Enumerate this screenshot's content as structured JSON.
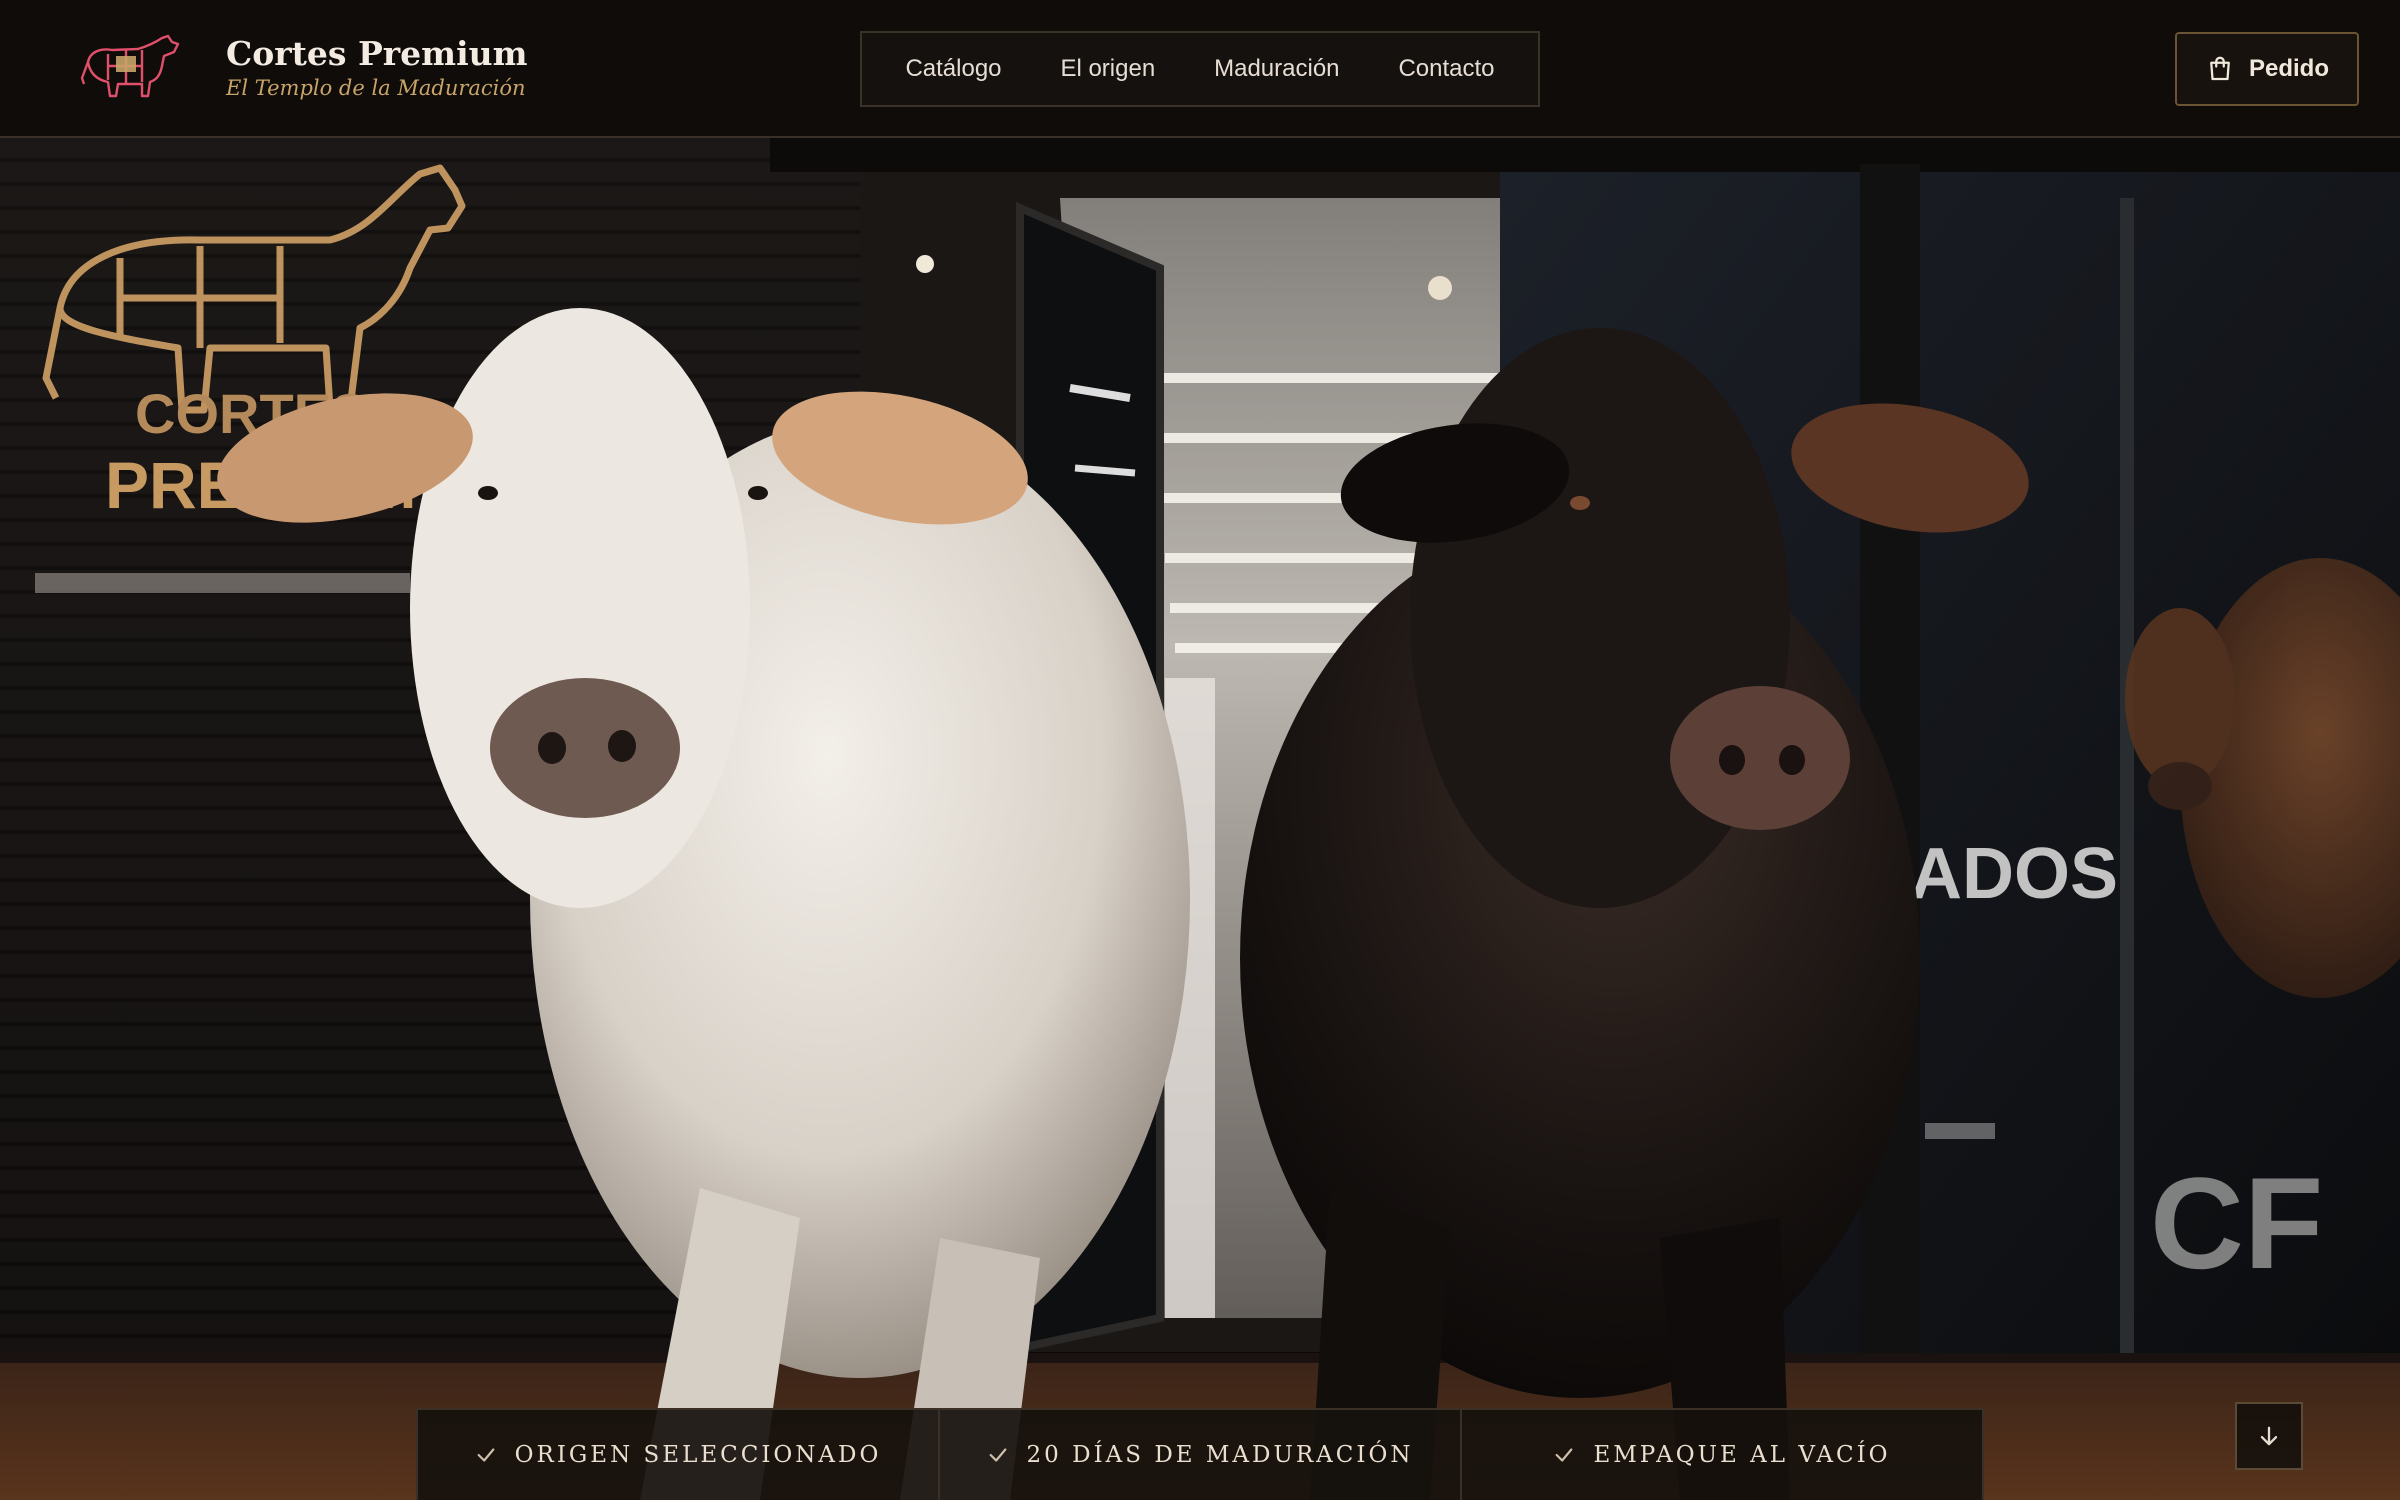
{
  "brand": {
    "title": "Cortes Premium",
    "tagline": "El Templo de la Maduración"
  },
  "nav": {
    "items": [
      {
        "label": "Catálogo"
      },
      {
        "label": "El origen"
      },
      {
        "label": "Maduración"
      },
      {
        "label": "Contacto"
      }
    ]
  },
  "cta": {
    "label": "Pedido",
    "icon": "shopping-bag-icon"
  },
  "scene": {
    "sign_line1": "CORTES",
    "sign_line2": "PREMIUM",
    "window_text": "ADOS",
    "emblem": "CF"
  },
  "features": [
    {
      "label": "ORIGEN SELECCIONADO",
      "icon": "check-icon"
    },
    {
      "label": "20 DÍAS DE MADURACIÓN",
      "icon": "check-icon"
    },
    {
      "label": "EMPAQUE AL VACÍO",
      "icon": "check-icon"
    }
  ],
  "scroll": {
    "icon": "arrow-down-icon"
  },
  "colors": {
    "background": "#0b0908",
    "accent_gold": "#c8a468",
    "text_light": "#f4ece2",
    "border": "#3a3027"
  }
}
